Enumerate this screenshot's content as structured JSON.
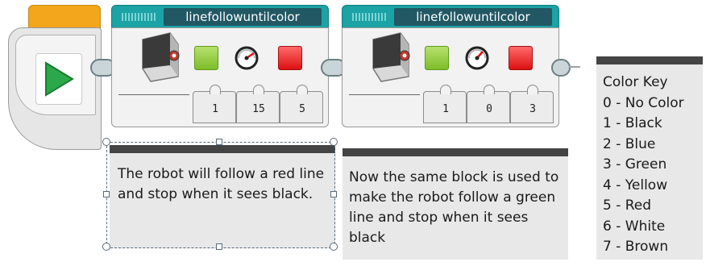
{
  "colors": {
    "block_header": "#1ba3a5",
    "block_title_bg": "#215864",
    "start_accent": "#f3a51b",
    "play": "#2aa84a",
    "comment_bg": "#e8e8e8",
    "comment_bar": "#444444"
  },
  "start_block": {
    "icon": "play-icon"
  },
  "blocks": [
    {
      "title": "linefollowuntilcolor",
      "icons": [
        "color-sensor-icon",
        "green-color-icon",
        "speed-gauge-icon",
        "red-color-icon"
      ],
      "params": [
        "1",
        "15",
        "5"
      ]
    },
    {
      "title": "linefollowuntilcolor",
      "icons": [
        "color-sensor-icon",
        "green-color-icon",
        "speed-gauge-icon",
        "red-color-icon"
      ],
      "params": [
        "1",
        "0",
        "3"
      ]
    }
  ],
  "comments": [
    {
      "text": "The robot will follow a red line and stop when it sees black."
    },
    {
      "text": "Now the same block is used to make the robot follow a green line and stop when it sees black"
    }
  ],
  "color_key": {
    "title": "Color Key",
    "items": [
      "0 - No Color",
      "1 - Black",
      "2 - Blue",
      "3 - Green",
      "4 - Yellow",
      "5 - Red",
      "6 - White",
      "7 - Brown"
    ]
  }
}
